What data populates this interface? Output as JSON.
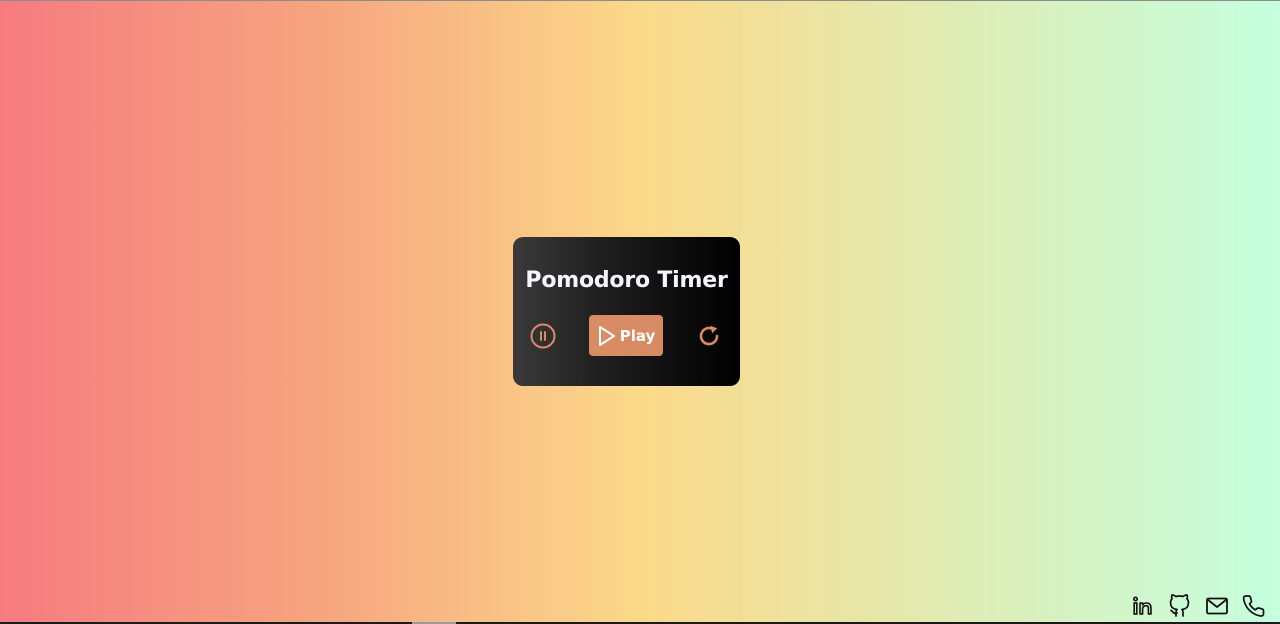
{
  "page": {
    "title": "Pomodoro Timer"
  },
  "timer": {
    "play_label": "Play",
    "controls": {
      "pause_icon": "pause-circle-icon",
      "play_icon": "play-triangle-icon",
      "reset_icon": "rotate-cw-icon"
    },
    "colors": {
      "accent": "#d98b63",
      "card_dark": "#000000",
      "title_text": "#f4f7ff"
    }
  },
  "footer": {
    "social_icons": [
      "linkedin-icon",
      "github-icon",
      "mail-icon",
      "phone-icon"
    ]
  },
  "background": {
    "gradient_stops": [
      "#f67b80",
      "#f6a57f",
      "#fbd98a",
      "#dfecb4",
      "#c5ffdf"
    ]
  }
}
